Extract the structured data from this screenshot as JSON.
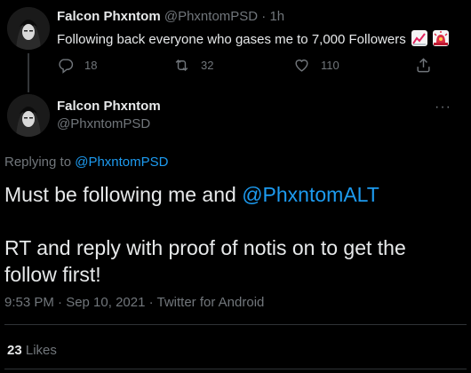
{
  "previous_tweet": {
    "display_name": "Falcon Phxntom",
    "handle": "@PhxntomPSD",
    "separator": "·",
    "time_ago": "1h",
    "text": "Following back everyone who gases me to 7,000 Followers",
    "emojis": [
      "chart-increasing-icon",
      "police-light-icon"
    ],
    "reply_count": "18",
    "retweet_count": "32",
    "like_count": "110"
  },
  "main_tweet": {
    "display_name": "Falcon Phxntom",
    "handle": "@PhxntomPSD",
    "more_label": "···",
    "replying_prefix": "Replying to",
    "replying_to": "@PhxntomPSD",
    "body_line1_prefix": "Must be following me and",
    "body_line1_mention": "@PhxntomALT",
    "body_line2": "RT and reply with proof of notis on to get the",
    "body_line3": "follow first!",
    "timestamp": "9:53 PM · Sep 10, 2021 · Twitter for Android",
    "likes_count": "23",
    "likes_label": "Likes"
  },
  "colors": {
    "background": "#000000",
    "text_primary": "#e7e9ea",
    "text_secondary": "#71767b",
    "accent": "#1d9bf0",
    "divider": "#2f3336"
  }
}
